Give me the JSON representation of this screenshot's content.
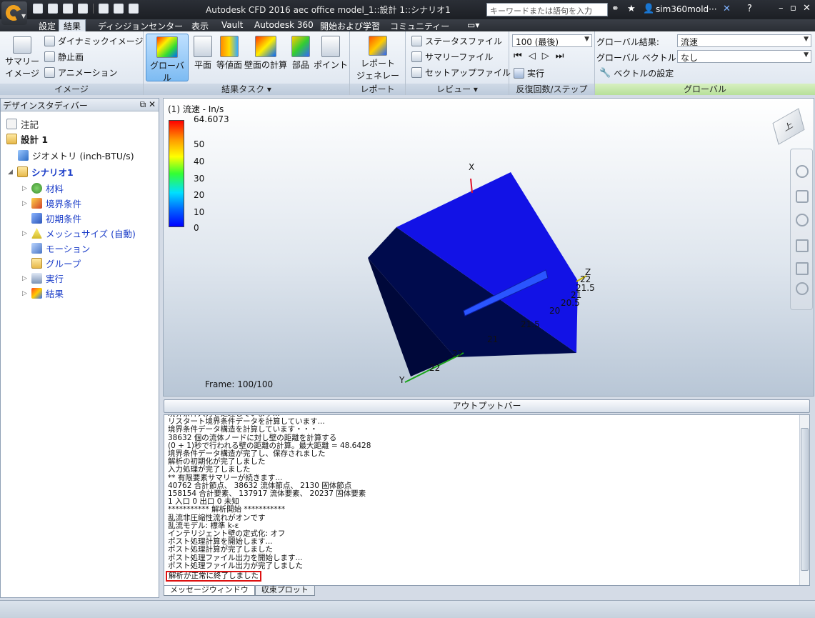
{
  "titlebar": {
    "title": "Autodesk CFD 2016   aec office model_1::設計 1::シナリオ1",
    "search_placeholder": "キーワードまたは語句を入力",
    "user": "sim360mold···"
  },
  "tabs": [
    "設定",
    "結果",
    "ディシジョンセンター",
    "表示",
    "Vault",
    "Autodesk 360",
    "開始および学習",
    "コミュニティー"
  ],
  "active_tab": "結果",
  "ribbon": {
    "image_group": {
      "label": "イメージ",
      "summary_line1": "サマリー",
      "summary_line2": "イメージ",
      "items": [
        "ダイナミックイメージ",
        "静止画",
        "アニメーション"
      ]
    },
    "result_tasks": {
      "label": "結果タスク ▾",
      "buttons": [
        "グローバル",
        "平面",
        "等値面",
        "壁面の計算",
        "部品",
        "ポイント"
      ]
    },
    "report": {
      "label": "レポート",
      "line1": "レポート",
      "line2": "ジェネレータ"
    },
    "review": {
      "label": "レビュー ▾",
      "items": [
        "ステータスファイル",
        "サマリーファイル",
        "セットアップファイル"
      ]
    },
    "iterations": {
      "label": "反復回数/ステップ",
      "combo_value": "100 (最後)",
      "run_label": "実行"
    },
    "global": {
      "label": "グローバル",
      "result_label": "グローバル結果:",
      "result_value": "流速",
      "vector_label": "グローバル ベクトル:",
      "vector_value": "なし",
      "vector_settings": "ベクトルの設定"
    }
  },
  "design_study_bar": {
    "title": "デザインスタディバー",
    "items": [
      {
        "label": "注記"
      },
      {
        "label": "設計 1"
      },
      {
        "label": "ジオメトリ (inch-BTU/s)"
      },
      {
        "label": "シナリオ1"
      },
      {
        "label": "材料"
      },
      {
        "label": "境界条件"
      },
      {
        "label": "初期条件"
      },
      {
        "label": "メッシュサイズ (自動)"
      },
      {
        "label": "モーション"
      },
      {
        "label": "グループ"
      },
      {
        "label": "実行"
      },
      {
        "label": "結果"
      }
    ]
  },
  "viewport": {
    "legend_title": "(1) 流速 - In/s",
    "legend_max": "64.6073",
    "legend_ticks": [
      "50",
      "40",
      "30",
      "20",
      "10",
      "0"
    ],
    "frame": "Frame: 100/100",
    "viewcube_label": "上",
    "axis_labels": [
      "X",
      "Y",
      "Z"
    ],
    "axis_ticks": [
      "22",
      "21.5",
      "21",
      "20.5",
      "20",
      "21.5",
      "21",
      "22",
      "22"
    ]
  },
  "output_bar": {
    "title": "アウトプットバー",
    "lines": [
      "境界条件入力を処理しています...",
      "リスタート境界条件データを計算しています...",
      "境界条件データ構造を計算しています・・・",
      "38632 個の流体ノードに対し壁の距離を計算する",
      "(0 + 1)秒で行われる壁の距離の計算。最大距離 = 48.6428",
      "境界条件データ構造が完了し、保存されました",
      "解析の初期化が完了しました",
      "入力処理が完了しました",
      "** 有限要素サマリーが続きます...",
      "40762 合計節点、 38632 流体節点、 2130 固体節点",
      "158154 合計要素、 137917 流体要素、 20237 固体要素",
      "1 入口  0 出口  0 未知",
      "*********** 解析開始 ***********",
      "乱流非圧縮性流れがオンです",
      "乱流モデル: 標準 k-ε",
      "インテリジェント壁の定式化: オフ",
      "ポスト処理計算を開始します...",
      "ポスト処理計算が完了しました",
      "ポスト処理ファイル出力を開始します...",
      "ポスト処理ファイル出力が完了しました"
    ],
    "final_line": "解析が正常に終了しました",
    "bottom_tabs": [
      "メッセージウィンドウ",
      "収束プロット"
    ]
  },
  "colors": {
    "accent_blue": "#1a3cc8",
    "model_blue": "#1a1aef",
    "highlight_red": "#d11111"
  }
}
